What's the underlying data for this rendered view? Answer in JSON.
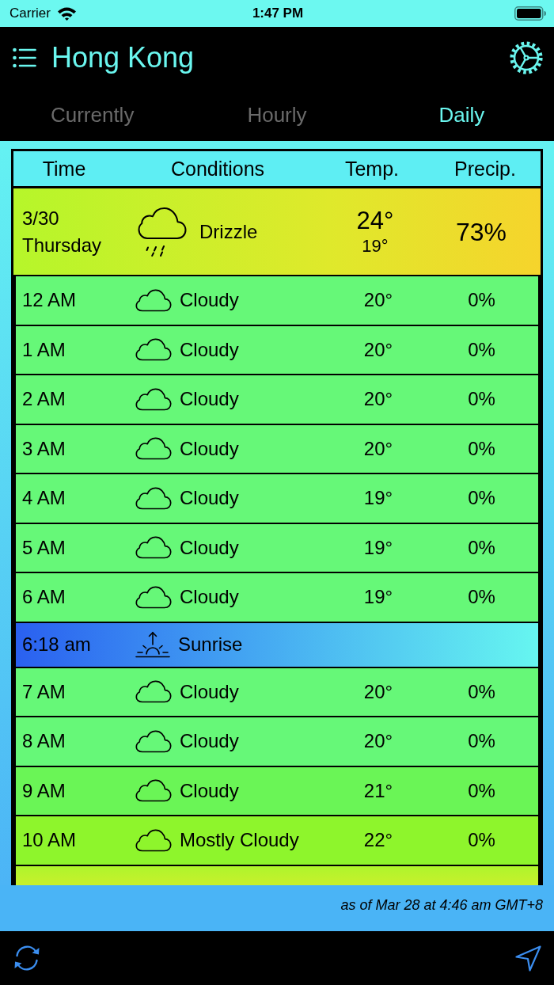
{
  "status_bar": {
    "carrier": "Carrier",
    "time": "1:47 PM"
  },
  "header": {
    "title": "Hong Kong"
  },
  "tabs": [
    {
      "label": "Currently",
      "selected": false
    },
    {
      "label": "Hourly",
      "selected": false
    },
    {
      "label": "Daily",
      "selected": true
    }
  ],
  "table": {
    "columns": [
      "Time",
      "Conditions",
      "Temp.",
      "Precip."
    ],
    "day": {
      "date": "3/30",
      "weekday": "Thursday",
      "conditions": "Drizzle",
      "high": "24°",
      "low": "19°",
      "precip": "73%"
    },
    "rows": [
      {
        "kind": "hour",
        "time": "12 AM",
        "conditions": "Cloudy",
        "temp": "20°",
        "precip": "0%",
        "color": "#66f878"
      },
      {
        "kind": "hour",
        "time": "1 AM",
        "conditions": "Cloudy",
        "temp": "20°",
        "precip": "0%",
        "color": "#66f878"
      },
      {
        "kind": "hour",
        "time": "2 AM",
        "conditions": "Cloudy",
        "temp": "20°",
        "precip": "0%",
        "color": "#66f878"
      },
      {
        "kind": "hour",
        "time": "3 AM",
        "conditions": "Cloudy",
        "temp": "20°",
        "precip": "0%",
        "color": "#66f878"
      },
      {
        "kind": "hour",
        "time": "4 AM",
        "conditions": "Cloudy",
        "temp": "19°",
        "precip": "0%",
        "color": "#66f878"
      },
      {
        "kind": "hour",
        "time": "5 AM",
        "conditions": "Cloudy",
        "temp": "19°",
        "precip": "0%",
        "color": "#66f878"
      },
      {
        "kind": "hour",
        "time": "6 AM",
        "conditions": "Cloudy",
        "temp": "19°",
        "precip": "0%",
        "color": "#66f878"
      },
      {
        "kind": "sunrise",
        "time": "6:18 am",
        "label": "Sunrise"
      },
      {
        "kind": "hour",
        "time": "7 AM",
        "conditions": "Cloudy",
        "temp": "20°",
        "precip": "0%",
        "color": "#66f878"
      },
      {
        "kind": "hour",
        "time": "8 AM",
        "conditions": "Cloudy",
        "temp": "20°",
        "precip": "0%",
        "color": "#66f878"
      },
      {
        "kind": "hour",
        "time": "9 AM",
        "conditions": "Cloudy",
        "temp": "21°",
        "precip": "0%",
        "color": "#6af556"
      },
      {
        "kind": "hour",
        "time": "10 AM",
        "conditions": "Mostly Cloudy",
        "temp": "22°",
        "precip": "0%",
        "color": "#8ef52c"
      }
    ]
  },
  "footer": {
    "updated": "as of Mar 28 at 4:46 am GMT+8"
  }
}
